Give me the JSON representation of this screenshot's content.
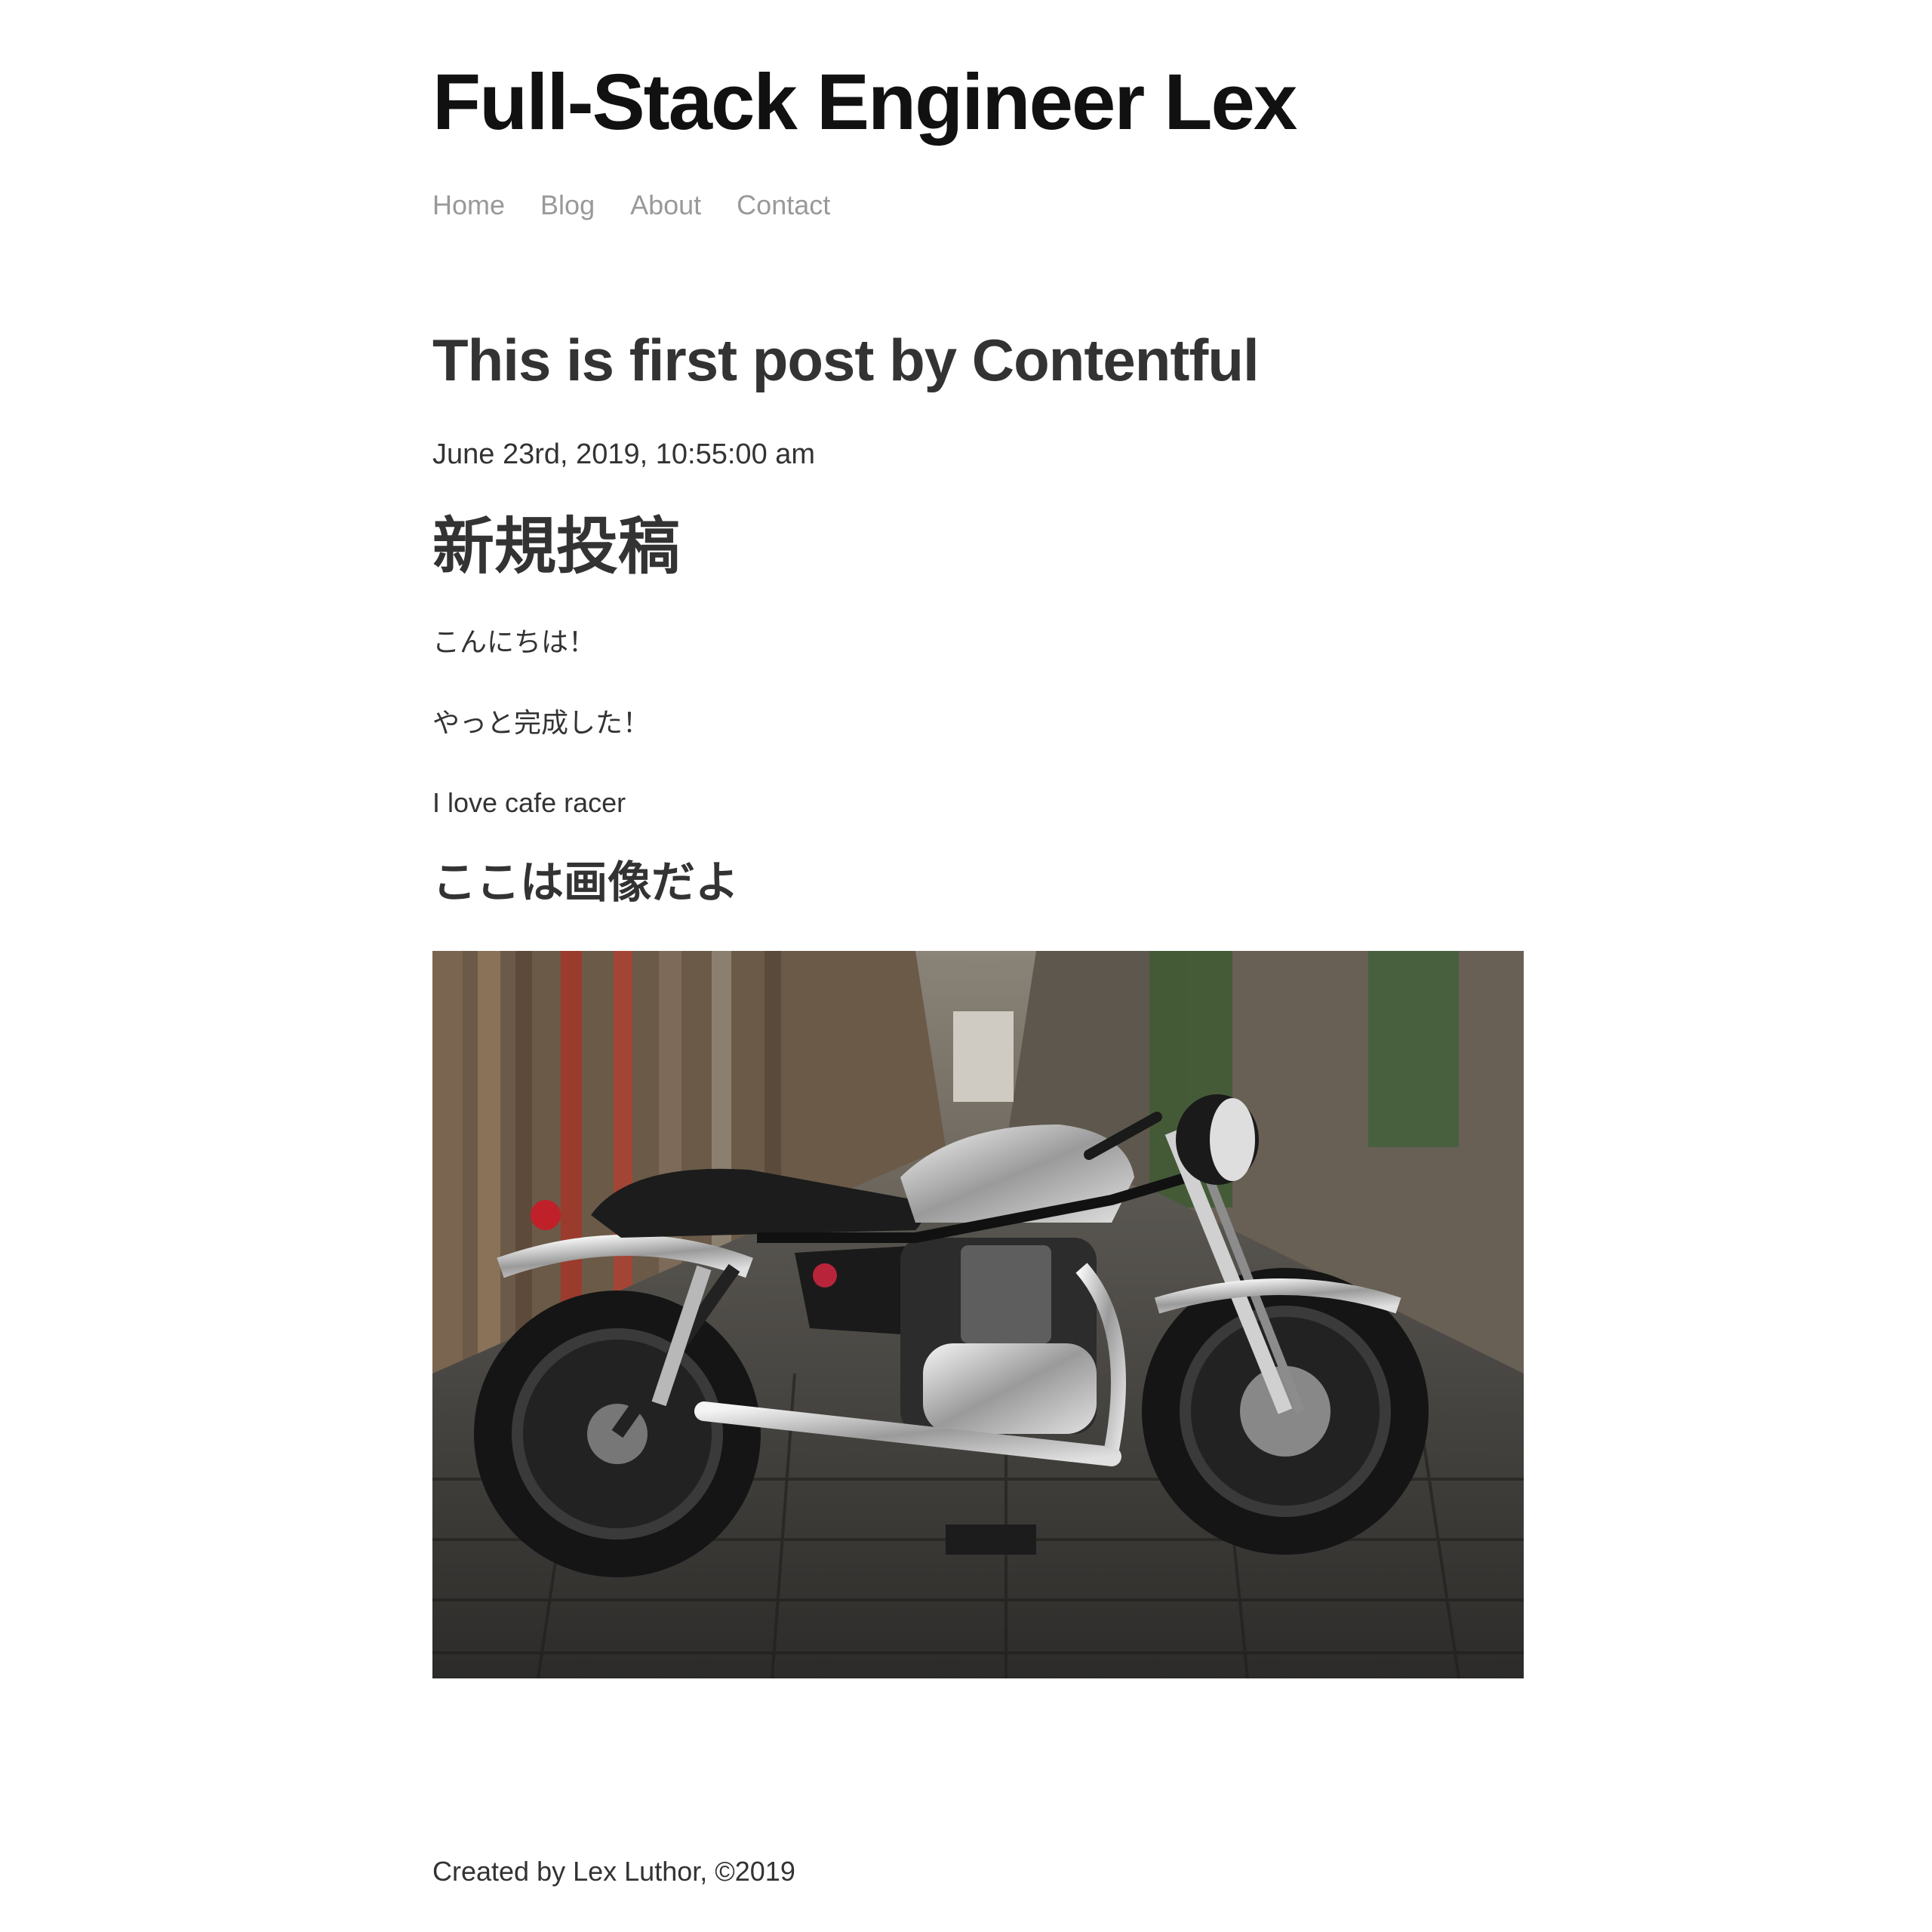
{
  "site": {
    "title": "Full-Stack Engineer Lex"
  },
  "nav": {
    "items": [
      {
        "label": "Home"
      },
      {
        "label": "Blog"
      },
      {
        "label": "About"
      },
      {
        "label": "Contact"
      }
    ]
  },
  "post": {
    "title": "This is first post by Contentful",
    "date": "June 23rd, 2019, 10:55:00 am",
    "heading": "新規投稿",
    "paragraphs": [
      "こんにちは！",
      "やっと完成した！",
      "I love cafe racer"
    ],
    "subheading": "ここは画像だよ",
    "image": {
      "description": "cafe-racer-motorcycle-photo"
    }
  },
  "footer": {
    "text": "Created by Lex Luthor, ©2019"
  },
  "colors": {
    "title": "#111111",
    "text": "#333333",
    "nav": "#999999",
    "background": "#ffffff"
  }
}
